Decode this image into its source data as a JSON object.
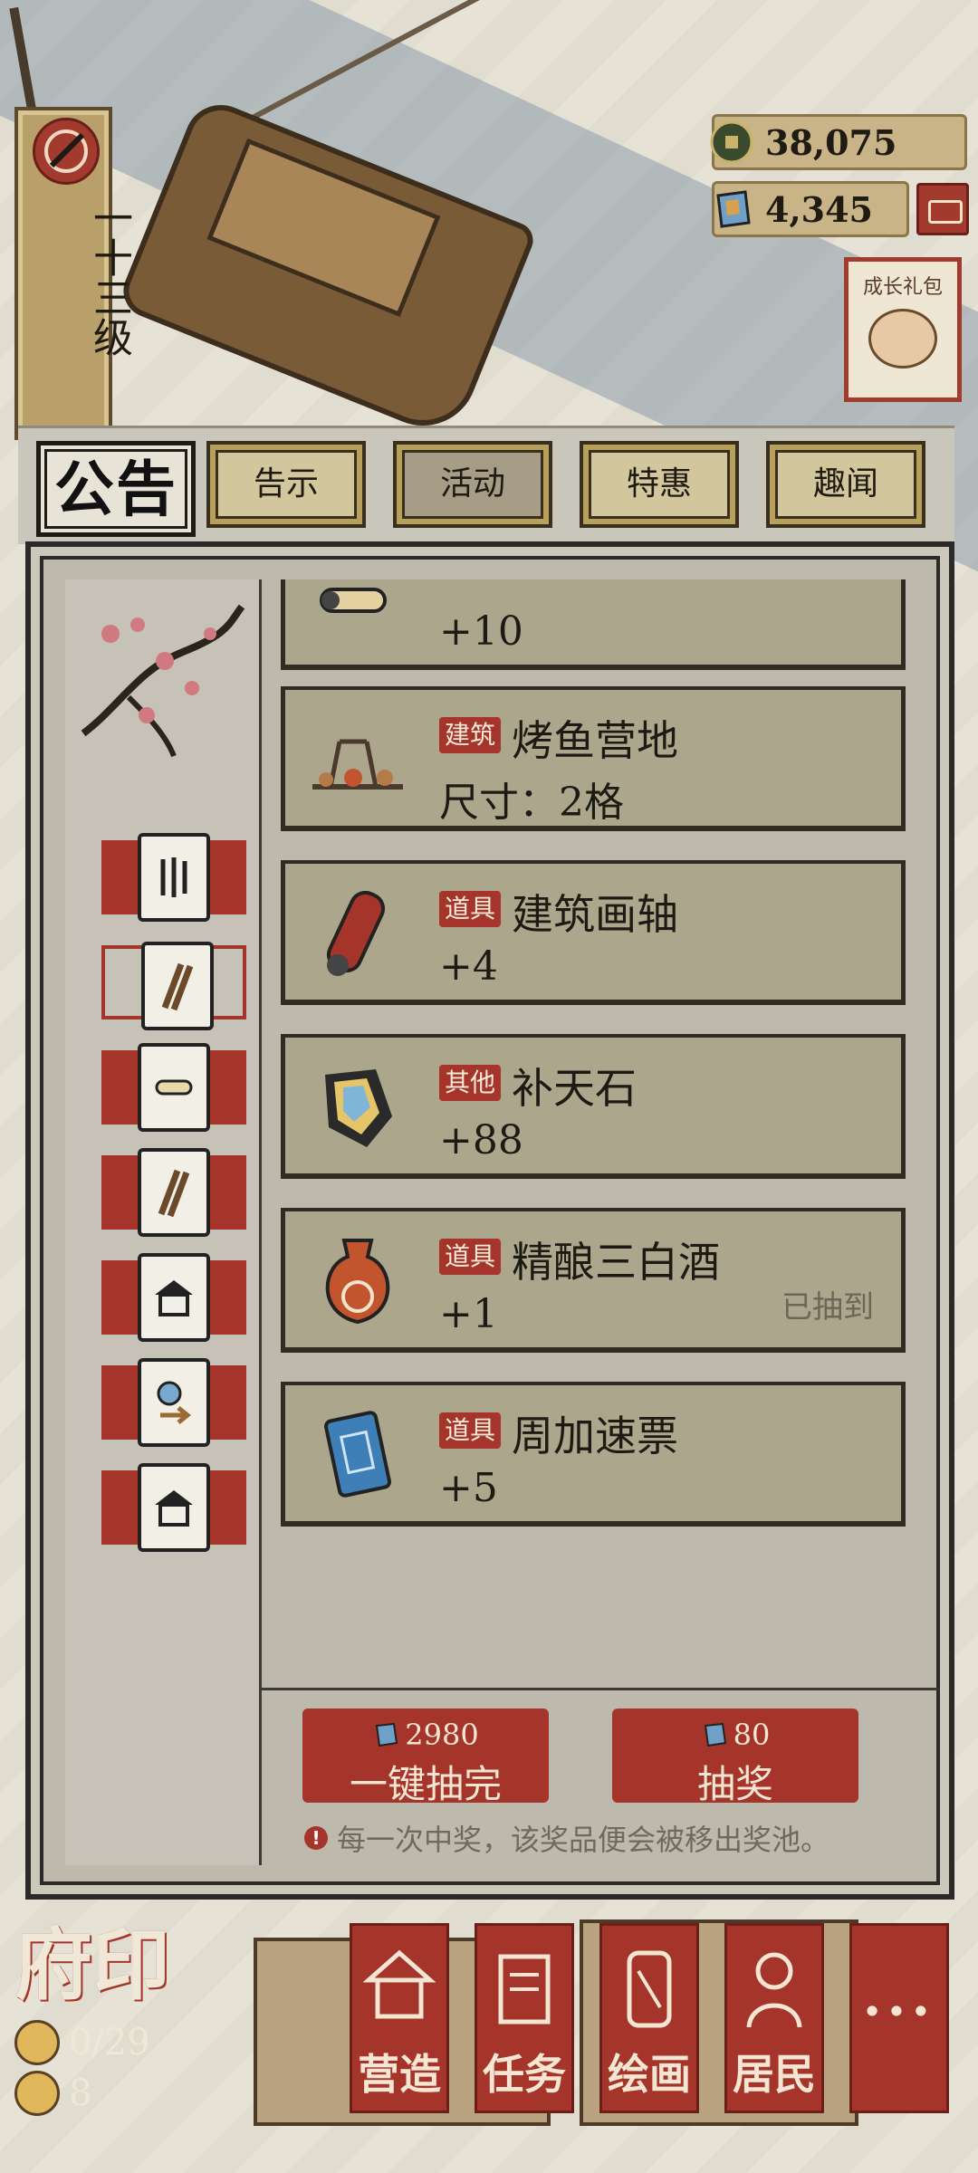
{
  "hud": {
    "level": "一十三级",
    "coins": "38,075",
    "gems": "4,345",
    "growth_pack": "成长礼包"
  },
  "panel": {
    "title": "公告",
    "tabs": [
      {
        "label": "告示",
        "active": false
      },
      {
        "label": "活动",
        "active": true
      },
      {
        "label": "特惠",
        "active": false
      },
      {
        "label": "趣闻",
        "active": false
      }
    ]
  },
  "items": [
    {
      "tag": "",
      "name": "",
      "amount": "+10",
      "status": "",
      "icon": "scroll-icon"
    },
    {
      "tag": "建筑",
      "name": "烤鱼营地",
      "amount": "尺寸：2格",
      "status": "",
      "icon": "campfire-icon"
    },
    {
      "tag": "道具",
      "name": "建筑画轴",
      "amount": "+4",
      "status": "",
      "icon": "scroll-icon"
    },
    {
      "tag": "其他",
      "name": "补天石",
      "amount": "+88",
      "status": "",
      "icon": "gem-stone-icon"
    },
    {
      "tag": "道具",
      "name": "精酿三白酒",
      "amount": "+1",
      "status": "已抽到",
      "icon": "wine-jar-icon"
    },
    {
      "tag": "道具",
      "name": "周加速票",
      "amount": "+5",
      "status": "",
      "icon": "ticket-icon"
    }
  ],
  "draw": {
    "all": {
      "cost": "2980",
      "label": "一键抽完"
    },
    "single": {
      "cost": "80",
      "label": "抽奖"
    },
    "note": "每一次中奖，该奖品便会被移出奖池。"
  },
  "seal": {
    "title": "府印",
    "residents": "0/29",
    "count": "8"
  },
  "nav": [
    {
      "label": "营造",
      "icon": "house-icon"
    },
    {
      "label": "任务",
      "icon": "book-icon"
    },
    {
      "label": "绘画",
      "icon": "scroll-icon"
    },
    {
      "label": "居民",
      "icon": "person-icon"
    },
    {
      "label": "···",
      "icon": ""
    }
  ],
  "colors": {
    "accent": "#a5342b",
    "panel": "#bdb9ad",
    "card": "#aca68d"
  }
}
